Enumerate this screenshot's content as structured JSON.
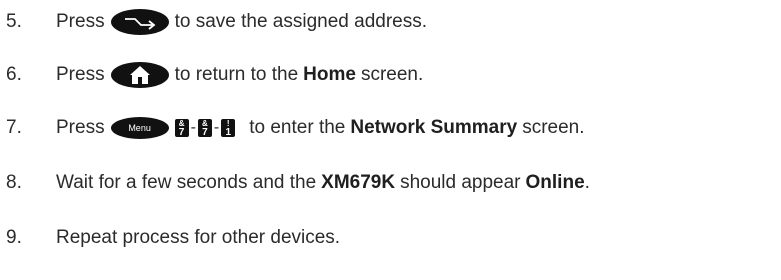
{
  "steps": [
    {
      "number": "5.",
      "press": "Press",
      "after": "to save the assigned address.",
      "icon": "enter-key-icon"
    },
    {
      "number": "6.",
      "press": "Press",
      "after_1": "to return to the",
      "bold": "Home",
      "after_2": "screen.",
      "icon": "home-key-icon"
    },
    {
      "number": "7.",
      "press": "Press",
      "menu_key": "Menu",
      "keys": [
        {
          "symbol": "&",
          "digit": "7"
        },
        {
          "symbol": "&",
          "digit": "7"
        },
        {
          "symbol": "!",
          "digit": "1"
        }
      ],
      "separator": "-",
      "after_1": "to enter the",
      "bold": "Network Summary",
      "after_2": "screen."
    },
    {
      "number": "8.",
      "text_1": "Wait for a few seconds and the",
      "bold_1": "XM679K",
      "text_2": "should appear",
      "bold_2": "Online",
      "text_3": "."
    },
    {
      "number": "9.",
      "text": "Repeat process for other devices."
    }
  ],
  "colors": {
    "text": "#2b2b2b",
    "key_bg": "#111111",
    "key_fg": "#ffffff"
  }
}
